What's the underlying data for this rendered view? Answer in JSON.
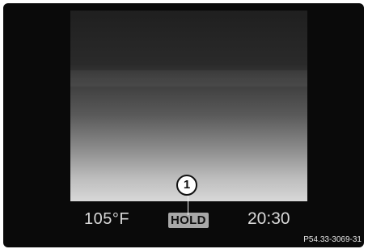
{
  "display": {
    "temperature": "105°F",
    "hold_label": "HOLD",
    "clock": "20:30"
  },
  "callout": {
    "number": "1"
  },
  "reference_code": "P54.33-3069-31"
}
